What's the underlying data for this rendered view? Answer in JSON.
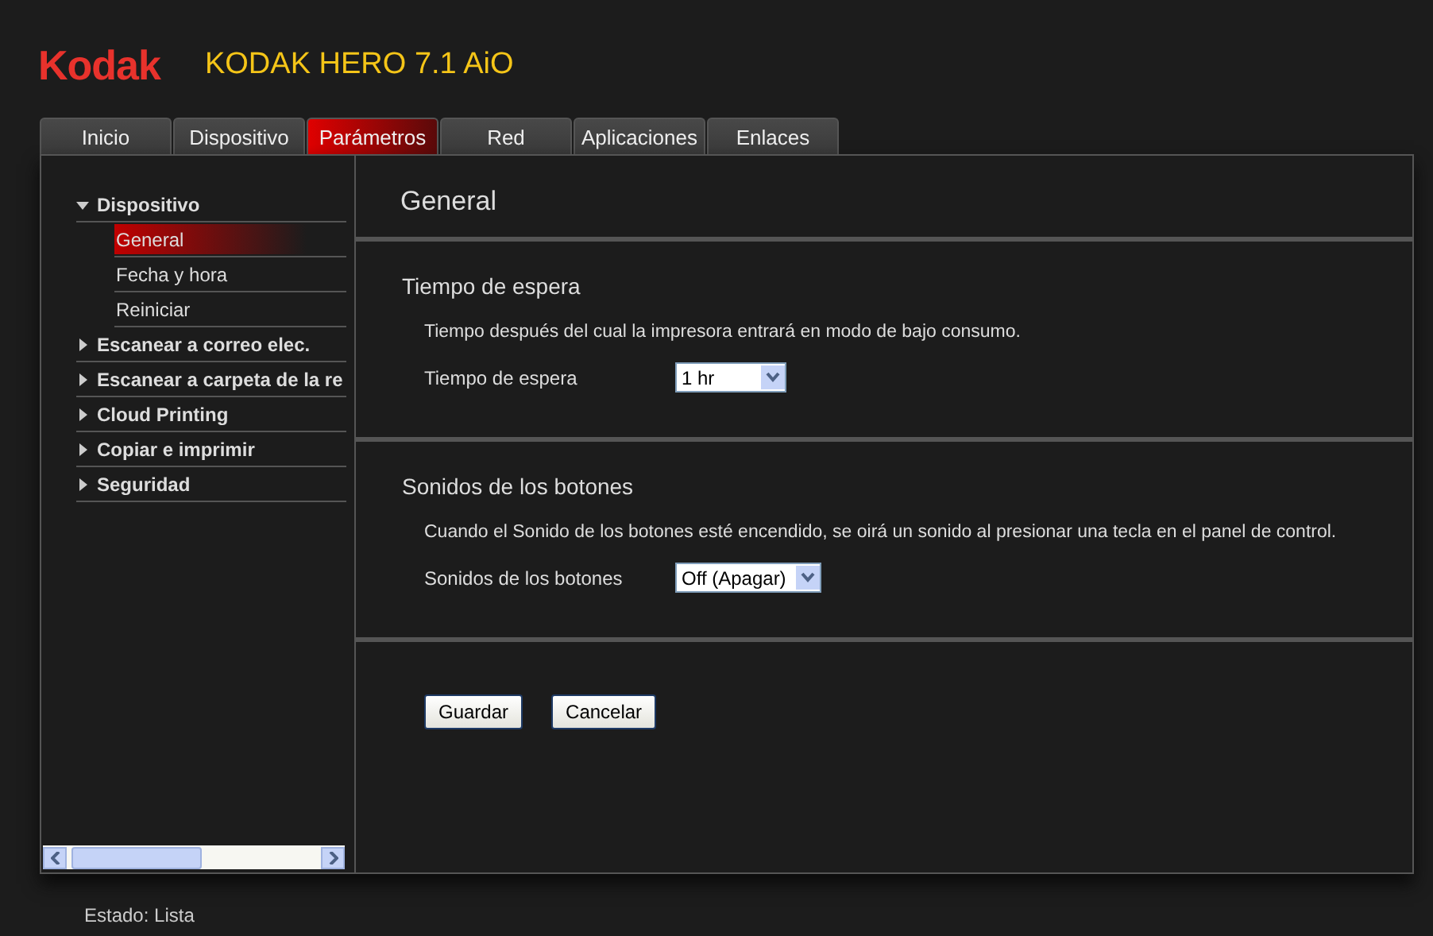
{
  "header": {
    "logo": "Kodak",
    "title": "KODAK HERO 7.1 AiO"
  },
  "tabs": [
    {
      "label": "Inicio",
      "selected": false
    },
    {
      "label": "Dispositivo",
      "selected": false
    },
    {
      "label": "Parámetros",
      "selected": true
    },
    {
      "label": "Red",
      "selected": false
    },
    {
      "label": "Aplicaciones",
      "selected": false
    },
    {
      "label": "Enlaces",
      "selected": false
    }
  ],
  "sidebar": {
    "items": [
      {
        "label": "Dispositivo",
        "expanded": true,
        "children": [
          {
            "label": "General",
            "selected": true
          },
          {
            "label": "Fecha y hora",
            "selected": false
          },
          {
            "label": "Reiniciar",
            "selected": false
          }
        ]
      },
      {
        "label": "Escanear a correo elec.",
        "expanded": false
      },
      {
        "label": "Escanear a carpeta de la re",
        "expanded": false
      },
      {
        "label": "Cloud Printing",
        "expanded": false
      },
      {
        "label": "Copiar e imprimir",
        "expanded": false
      },
      {
        "label": "Seguridad",
        "expanded": false
      }
    ]
  },
  "content": {
    "title": "General",
    "sections": [
      {
        "title": "Tiempo de espera",
        "description": "Tiempo después del cual la impresora entrará en modo de bajo consumo.",
        "field_label": "Tiempo de espera",
        "value": "1 hr"
      },
      {
        "title": "Sonidos de los botones",
        "description": "Cuando el Sonido de los botones esté encendido, se oirá un sonido al presionar una tecla en el panel de control.",
        "field_label": "Sonidos de los botones",
        "value": "Off (Apagar)"
      }
    ],
    "buttons": [
      "Guardar",
      "Cancelar"
    ]
  },
  "status_bar": {
    "text": "Estado: Lista"
  }
}
